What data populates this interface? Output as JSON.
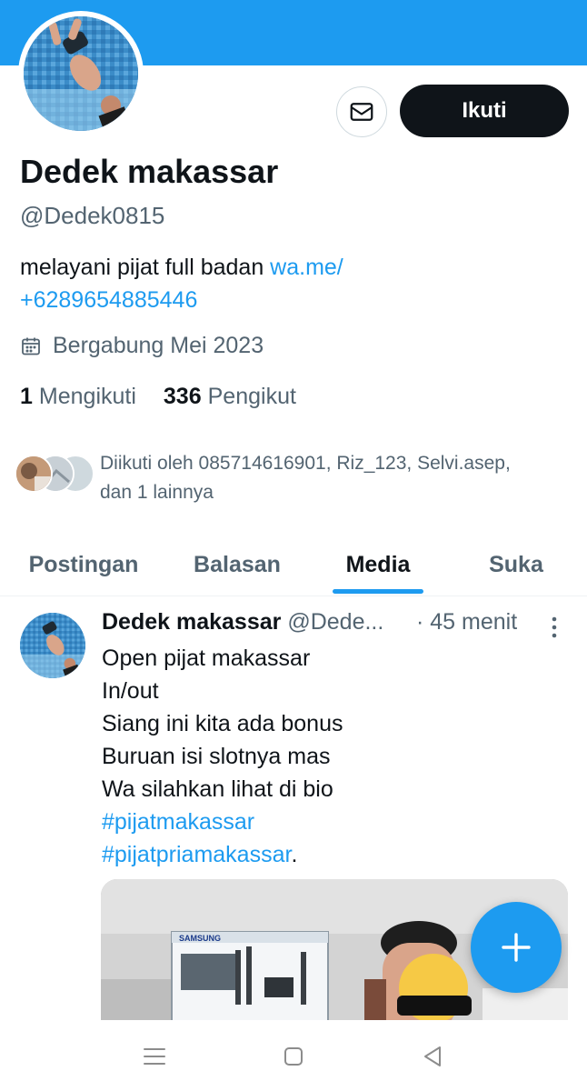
{
  "profile": {
    "display_name": "Dedek makassar",
    "handle": "@Dedek0815",
    "bio_text": "melayani pijat full badan ",
    "bio_link_line1": "wa.me/",
    "bio_link_line2": "+6289654885446",
    "joined": "Bergabung Mei 2023",
    "following_count": "1",
    "following_label": "Mengikuti",
    "followers_count": "336",
    "followers_label": "Pengikut",
    "followed_by_line1": "Diikuti oleh 085714616901, Riz_123, Selvi.asep,",
    "followed_by_line2": "dan 1 lainnya"
  },
  "actions": {
    "message_icon": "envelope-icon",
    "follow_label": "Ikuti"
  },
  "tabs": [
    {
      "label": "Postingan",
      "active": false
    },
    {
      "label": "Balasan",
      "active": false
    },
    {
      "label": "Media",
      "active": true
    },
    {
      "label": "Suka",
      "active": false
    }
  ],
  "post": {
    "author_name": "Dedek makassar",
    "author_handle": "@Dede...",
    "time": "· 45 menit",
    "lines": [
      "Open pijat makassar",
      "In/out",
      "Siang ini kita ada bonus",
      "Buruan isi slotnya mas",
      "Wa silahkan lihat di  bio"
    ],
    "hashtag1": "#pijatmakassar",
    "hashtag2": "#pijatpriamakassar",
    "hashtag2_suffix": ".",
    "media_box_brand": "SAMSUNG"
  },
  "colors": {
    "accent": "#1d9bf0",
    "text_primary": "#0f1419",
    "text_secondary": "#536471",
    "follow_button": "#0f1419"
  },
  "system_nav": {
    "icons": [
      "menu-icon",
      "home-square-icon",
      "back-triangle-icon"
    ]
  }
}
